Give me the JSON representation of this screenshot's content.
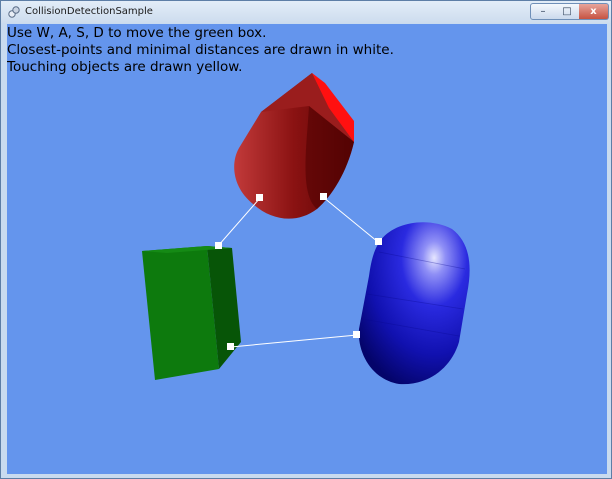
{
  "window": {
    "title": "CollisionDetectionSample",
    "icon": "app-icon",
    "controls": [
      {
        "name": "minimize",
        "glyph": "–"
      },
      {
        "name": "maximize",
        "glyph": "□"
      },
      {
        "name": "close",
        "glyph": "x"
      }
    ]
  },
  "scene": {
    "background_color": "#6495ed",
    "instructions": [
      "Use W, A, S, D to move the green box.",
      "Closest-points and minimal distances are drawn in white.",
      "Touching objects are drawn yellow."
    ],
    "objects": [
      {
        "name": "red-capsule",
        "color": "#8b0000"
      },
      {
        "name": "blue-capsule",
        "color": "#1a1ad0"
      },
      {
        "name": "green-box",
        "color": "#0f7a0f"
      }
    ],
    "distance_line_color": "#ffffff",
    "closest_point_color": "#ffffff"
  }
}
